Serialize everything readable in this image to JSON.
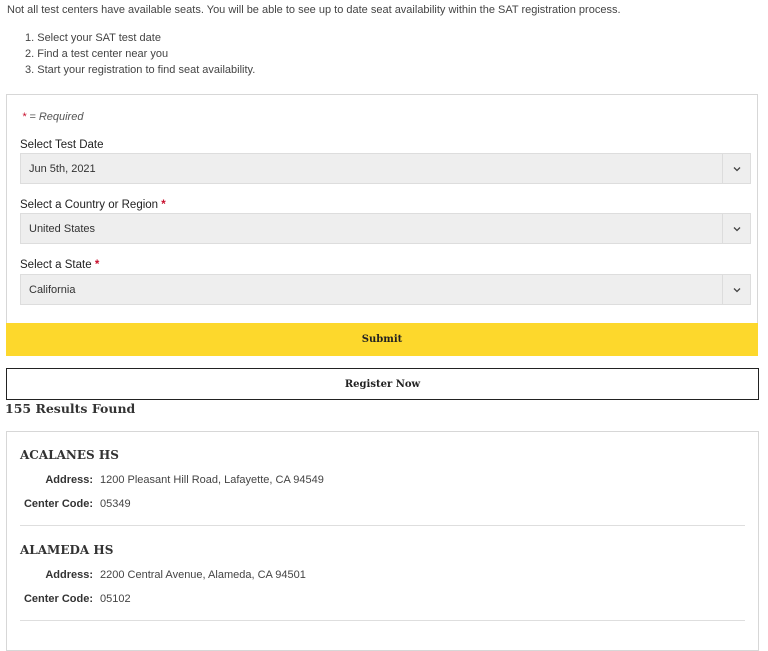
{
  "intro": "Not all test centers have available seats. You will be able to see up to date seat availability within the SAT registration process.",
  "steps": [
    "1. Select your SAT test date",
    "2. Find a test center near you",
    "3. Start your registration to find seat availability."
  ],
  "form": {
    "required_star": "*",
    "required_note": " = Required",
    "test_date": {
      "label": "Select Test Date",
      "value": "Jun 5th, 2021"
    },
    "country": {
      "label": "Select a Country or Region",
      "star": "*",
      "value": "United States"
    },
    "state": {
      "label": "Select a State",
      "star": "*",
      "value": "California"
    },
    "submit_label": "Submit"
  },
  "register_label": "Register Now",
  "results_count": "155 Results Found",
  "results": [
    {
      "name": "ACALANES HS",
      "address_label": "Address:",
      "address": "1200 Pleasant Hill Road, Lafayette, CA 94549",
      "code_label": "Center Code:",
      "code": "05349"
    },
    {
      "name": "ALAMEDA HS",
      "address_label": "Address:",
      "address": "2200 Central Avenue, Alameda, CA 94501",
      "code_label": "Center Code:",
      "code": "05102"
    }
  ],
  "colors": {
    "submit_bg": "#fdd82c",
    "required_star": "#c8102e"
  },
  "icons": {
    "select_caret": "chevron-down-icon"
  }
}
